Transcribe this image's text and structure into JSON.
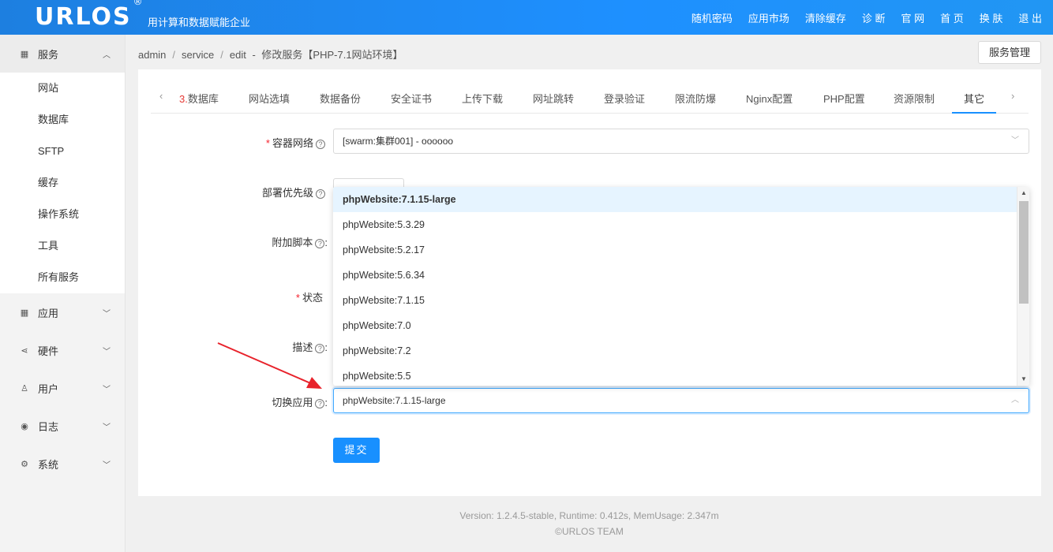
{
  "header": {
    "logo": "URLOS",
    "logo_mark": "®",
    "slogan": "用计算和数据赋能企业",
    "nav": [
      "随机密码",
      "应用市场",
      "清除缓存",
      "诊 断",
      "官 网",
      "首 页",
      "换 肤",
      "退 出"
    ]
  },
  "sidebar": {
    "groups": [
      {
        "label": "服务",
        "icon": "grid-icon",
        "expanded": true,
        "items": [
          "网站",
          "数据库",
          "SFTP",
          "缓存",
          "操作系统",
          "工具",
          "所有服务"
        ]
      },
      {
        "label": "应用",
        "icon": "apps-icon"
      },
      {
        "label": "硬件",
        "icon": "share-icon"
      },
      {
        "label": "用户",
        "icon": "user-icon"
      },
      {
        "label": "日志",
        "icon": "eye-icon"
      },
      {
        "label": "系统",
        "icon": "gear-icon"
      }
    ]
  },
  "breadcrumb": {
    "items": [
      "admin",
      "service",
      "edit"
    ],
    "title": "修改服务【PHP-7.1网站环境】"
  },
  "service_manage_button": "服务管理",
  "tabs": {
    "items": [
      {
        "prefix": "3.",
        "label": "数据库"
      },
      {
        "label": "网站选填"
      },
      {
        "label": "数据备份"
      },
      {
        "label": "安全证书"
      },
      {
        "label": "上传下载"
      },
      {
        "label": "网址跳转"
      },
      {
        "label": "登录验证"
      },
      {
        "label": "限流防爆"
      },
      {
        "label": "Nginx配置"
      },
      {
        "label": "PHP配置"
      },
      {
        "label": "资源限制"
      },
      {
        "label": "其它",
        "active": true
      }
    ]
  },
  "form": {
    "network_label": "容器网络",
    "network_value": "[swarm:集群001] - oooooo",
    "priority_label": "部署优先级",
    "script_label": "附加脚本",
    "status_label": "状态",
    "desc_label": "描述",
    "switch_label": "切换应用",
    "switch_value": "phpWebsite:7.1.15-large",
    "colon": ":",
    "submit_label": "提交"
  },
  "dropdown_options": [
    "phpWebsite:7.1.15-large",
    "phpWebsite:5.3.29",
    "phpWebsite:5.2.17",
    "phpWebsite:5.6.34",
    "phpWebsite:7.1.15",
    "phpWebsite:7.0",
    "phpWebsite:7.2",
    "phpWebsite:5.5"
  ],
  "footer": {
    "line1": "Version: 1.2.4.5-stable,   Runtime: 0.412s,   MemUsage: 2.347m",
    "line2": "©URLOS TEAM"
  },
  "colors": {
    "accent": "#1890ff",
    "header": "#1e88e5",
    "required": "#f5222d",
    "arrow": "#e8222b"
  }
}
